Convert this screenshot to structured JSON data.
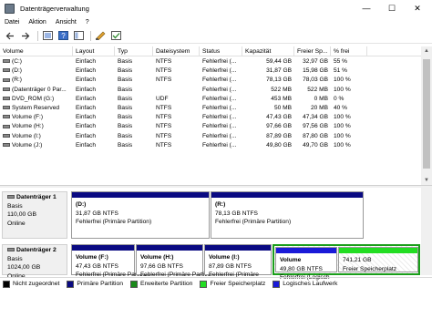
{
  "window": {
    "title": "Datenträgerverwaltung",
    "controls": {
      "minimize": "—",
      "maximize": "☐",
      "close": "✕"
    }
  },
  "menu": [
    "Datei",
    "Aktion",
    "Ansicht",
    "?"
  ],
  "toolbar": [
    "back-icon",
    "forward-icon",
    "list-icon",
    "help-icon",
    "panel-icon",
    "properties-icon",
    "settings-icon"
  ],
  "volume_list": {
    "columns": [
      "Volume",
      "Layout",
      "Typ",
      "Dateisystem",
      "Status",
      "Kapazität",
      "Freier Sp...",
      "% frei"
    ],
    "rows": [
      [
        "(C:)",
        "Einfach",
        "Basis",
        "NTFS",
        "Fehlerfrei (...",
        "59,44 GB",
        "32,97 GB",
        "55 %"
      ],
      [
        "(D:)",
        "Einfach",
        "Basis",
        "NTFS",
        "Fehlerfrei (...",
        "31,87 GB",
        "15,98 GB",
        "51 %"
      ],
      [
        "(R:)",
        "Einfach",
        "Basis",
        "NTFS",
        "Fehlerfrei (...",
        "78,13 GB",
        "78,03 GB",
        "100 %"
      ],
      [
        "(Datenträger 0 Par...",
        "Einfach",
        "Basis",
        "",
        "Fehlerfrei (...",
        "522 MB",
        "522 MB",
        "100 %"
      ],
      [
        "DVD_ROM (G:)",
        "Einfach",
        "Basis",
        "UDF",
        "Fehlerfrei (...",
        "453 MB",
        "0 MB",
        "0 %"
      ],
      [
        "System Reserved",
        "Einfach",
        "Basis",
        "NTFS",
        "Fehlerfrei (...",
        "50 MB",
        "20 MB",
        "40 %"
      ],
      [
        "Volume (F:)",
        "Einfach",
        "Basis",
        "NTFS",
        "Fehlerfrei (...",
        "47,43 GB",
        "47,34 GB",
        "100 %"
      ],
      [
        "Volume (H:)",
        "Einfach",
        "Basis",
        "NTFS",
        "Fehlerfrei (...",
        "97,66 GB",
        "97,56 GB",
        "100 %"
      ],
      [
        "Volume (I:)",
        "Einfach",
        "Basis",
        "NTFS",
        "Fehlerfrei (...",
        "87,89 GB",
        "87,80 GB",
        "100 %"
      ],
      [
        "Volume (J:)",
        "Einfach",
        "Basis",
        "NTFS",
        "Fehlerfrei (...",
        "49,80 GB",
        "49,70 GB",
        "100 %"
      ]
    ]
  },
  "disks": [
    {
      "name": "Datenträger 1",
      "type": "Basis",
      "size": "110,00 GB",
      "state": "Online",
      "partitions": [
        {
          "title": "(D:)",
          "size": "31,87 GB NTFS",
          "status": "Fehlerfrei (Primäre Partition)",
          "color": "#0a0a82"
        },
        {
          "title": "(R:)",
          "size": "78,13 GB NTFS",
          "status": "Fehlerfrei (Primäre Partition)",
          "color": "#0a0a82"
        }
      ]
    },
    {
      "name": "Datenträger 2",
      "type": "Basis",
      "size": "1024,00 GB",
      "state": "Online",
      "partitions": [
        {
          "title": "Volume  (F:)",
          "size": "47,43 GB NTFS",
          "status": "Fehlerfrei (Primäre Partition",
          "color": "#0a0a82"
        },
        {
          "title": "Volume  (H:)",
          "size": "97,66 GB NTFS",
          "status": "Fehlerfrei (Primäre Partitior",
          "color": "#0a0a82"
        },
        {
          "title": "Volume  (I:)",
          "size": "87,89 GB NTFS",
          "status": "Fehlerfrei (Primäre",
          "color": "#0a0a82"
        },
        {
          "title": "Volume",
          "size": "49,80 GB NTFS",
          "status": "Fehlerfrei (Logisch",
          "color": "#1a1ad8"
        },
        {
          "title": "",
          "size": "741,21 GB",
          "status": "Freier Speicherplatz",
          "color": "#22dd22"
        }
      ]
    }
  ],
  "legend": [
    {
      "label": "Nicht zugeordnet",
      "color": "#000000"
    },
    {
      "label": "Primäre Partition",
      "color": "#0a0a82"
    },
    {
      "label": "Erweiterte Partition",
      "color": "#1a8a1a"
    },
    {
      "label": "Freier Speicherplatz",
      "color": "#22dd22"
    },
    {
      "label": "Logisches Laufwerk",
      "color": "#1a1ad8"
    }
  ]
}
